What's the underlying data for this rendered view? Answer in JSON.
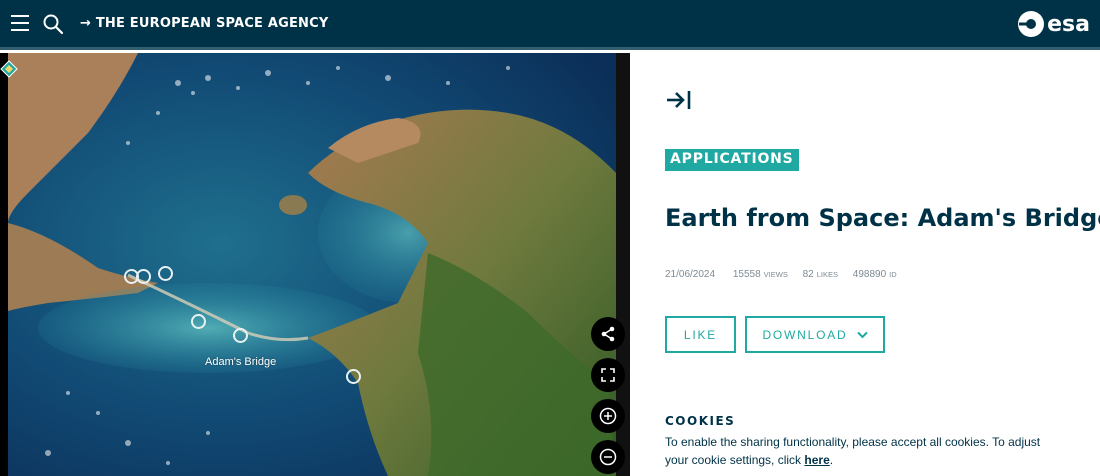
{
  "header": {
    "agency_label": "→ THE EUROPEAN SPACE AGENCY",
    "logo_text": "esa",
    "bg_color": "#003247"
  },
  "image_view": {
    "map_label": "Adam's Bridge"
  },
  "side_panel": {
    "category_badge": "APPLICATIONS",
    "title": "Earth from Space: Adam's Bridge",
    "meta": {
      "date": "21/06/2024",
      "views_value": "15558",
      "views_unit": "VIEWS",
      "likes_value": "82",
      "likes_unit": "LIKES",
      "id_value": "498890",
      "id_unit": "ID"
    },
    "like_label": "LIKE",
    "download_label": "DOWNLOAD",
    "cookies": {
      "title": "COOKIES",
      "text_before": "To enable the sharing functionality, please accept all cookies. To adjust your cookie settings, click ",
      "link_label": "here",
      "text_after": "."
    },
    "accent_color": "#1fa9a2"
  }
}
